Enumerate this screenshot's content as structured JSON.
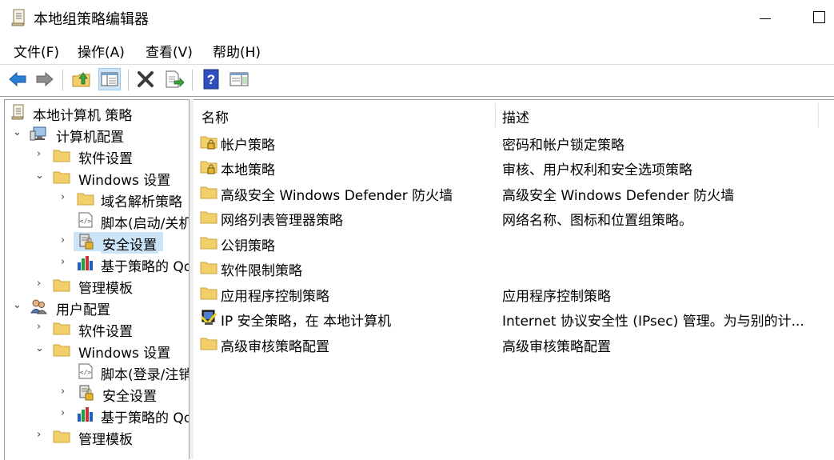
{
  "window": {
    "title": "本地组策略编辑器"
  },
  "menu": [
    {
      "label": "文件(F)"
    },
    {
      "label": "操作(A)"
    },
    {
      "label": "查看(V)"
    },
    {
      "label": "帮助(H)"
    }
  ],
  "toolbar": {
    "buttons": [
      "back-icon",
      "forward-icon",
      "up-folder-icon",
      "show-hide-tree-icon",
      "delete-icon",
      "export-list-icon",
      "help-icon",
      "properties-pane-icon"
    ]
  },
  "tree": {
    "items": [
      {
        "label": "本地计算机 策略",
        "icon": "policy-scroll-icon",
        "arrow": ""
      },
      {
        "label": "计算机配置",
        "icon": "computer-icon",
        "arrow": "expanded"
      },
      {
        "label": "软件设置",
        "icon": "folder-icon",
        "arrow": "collapsed"
      },
      {
        "label": "Windows 设置",
        "icon": "folder-icon",
        "arrow": "expanded"
      },
      {
        "label": "域名解析策略",
        "icon": "folder-icon",
        "arrow": "collapsed"
      },
      {
        "label": "脚本(启动/关机)",
        "icon": "script-icon",
        "arrow": ""
      },
      {
        "label": "安全设置",
        "icon": "security-settings-icon",
        "arrow": "collapsed",
        "selected": true
      },
      {
        "label": "基于策略的 QoS",
        "icon": "qos-chart-icon",
        "arrow": "collapsed"
      },
      {
        "label": "管理模板",
        "icon": "folder-icon",
        "arrow": "collapsed"
      },
      {
        "label": "用户配置",
        "icon": "users-icon",
        "arrow": "expanded"
      },
      {
        "label": "软件设置",
        "icon": "folder-icon",
        "arrow": "collapsed"
      },
      {
        "label": "Windows 设置",
        "icon": "folder-icon",
        "arrow": "expanded"
      },
      {
        "label": "脚本(登录/注销)",
        "icon": "script-icon",
        "arrow": ""
      },
      {
        "label": "安全设置",
        "icon": "security-settings-icon",
        "arrow": "collapsed"
      },
      {
        "label": "基于策略的 QoS",
        "icon": "qos-chart-icon",
        "arrow": "collapsed"
      },
      {
        "label": "管理模板",
        "icon": "folder-icon",
        "arrow": "collapsed"
      }
    ]
  },
  "list": {
    "columns": [
      {
        "label": "名称"
      },
      {
        "label": "描述"
      }
    ],
    "rows": [
      {
        "name": "帐户策略",
        "desc": "密码和帐户锁定策略",
        "icon": "locked-folder-icon"
      },
      {
        "name": "本地策略",
        "desc": "审核、用户权利和安全选项策略",
        "icon": "locked-folder-icon"
      },
      {
        "name": "高级安全 Windows Defender 防火墙",
        "desc": "高级安全 Windows Defender 防火墙",
        "icon": "folder-icon"
      },
      {
        "name": "网络列表管理器策略",
        "desc": "网络名称、图标和位置组策略。",
        "icon": "folder-icon"
      },
      {
        "name": "公钥策略",
        "desc": "",
        "icon": "folder-icon"
      },
      {
        "name": "软件限制策略",
        "desc": "",
        "icon": "folder-icon"
      },
      {
        "name": "应用程序控制策略",
        "desc": "应用程序控制策略",
        "icon": "folder-icon"
      },
      {
        "name": "IP 安全策略，在 本地计算机",
        "desc": "Internet 协议安全性 (IPsec) 管理。为与别的计...",
        "icon": "ipsec-monitor-icon"
      },
      {
        "name": "高级审核策略配置",
        "desc": "高级审核策略配置",
        "icon": "folder-icon"
      }
    ]
  },
  "colors": {
    "selection": "#cce4f7",
    "folder": "#f3cf6b"
  }
}
